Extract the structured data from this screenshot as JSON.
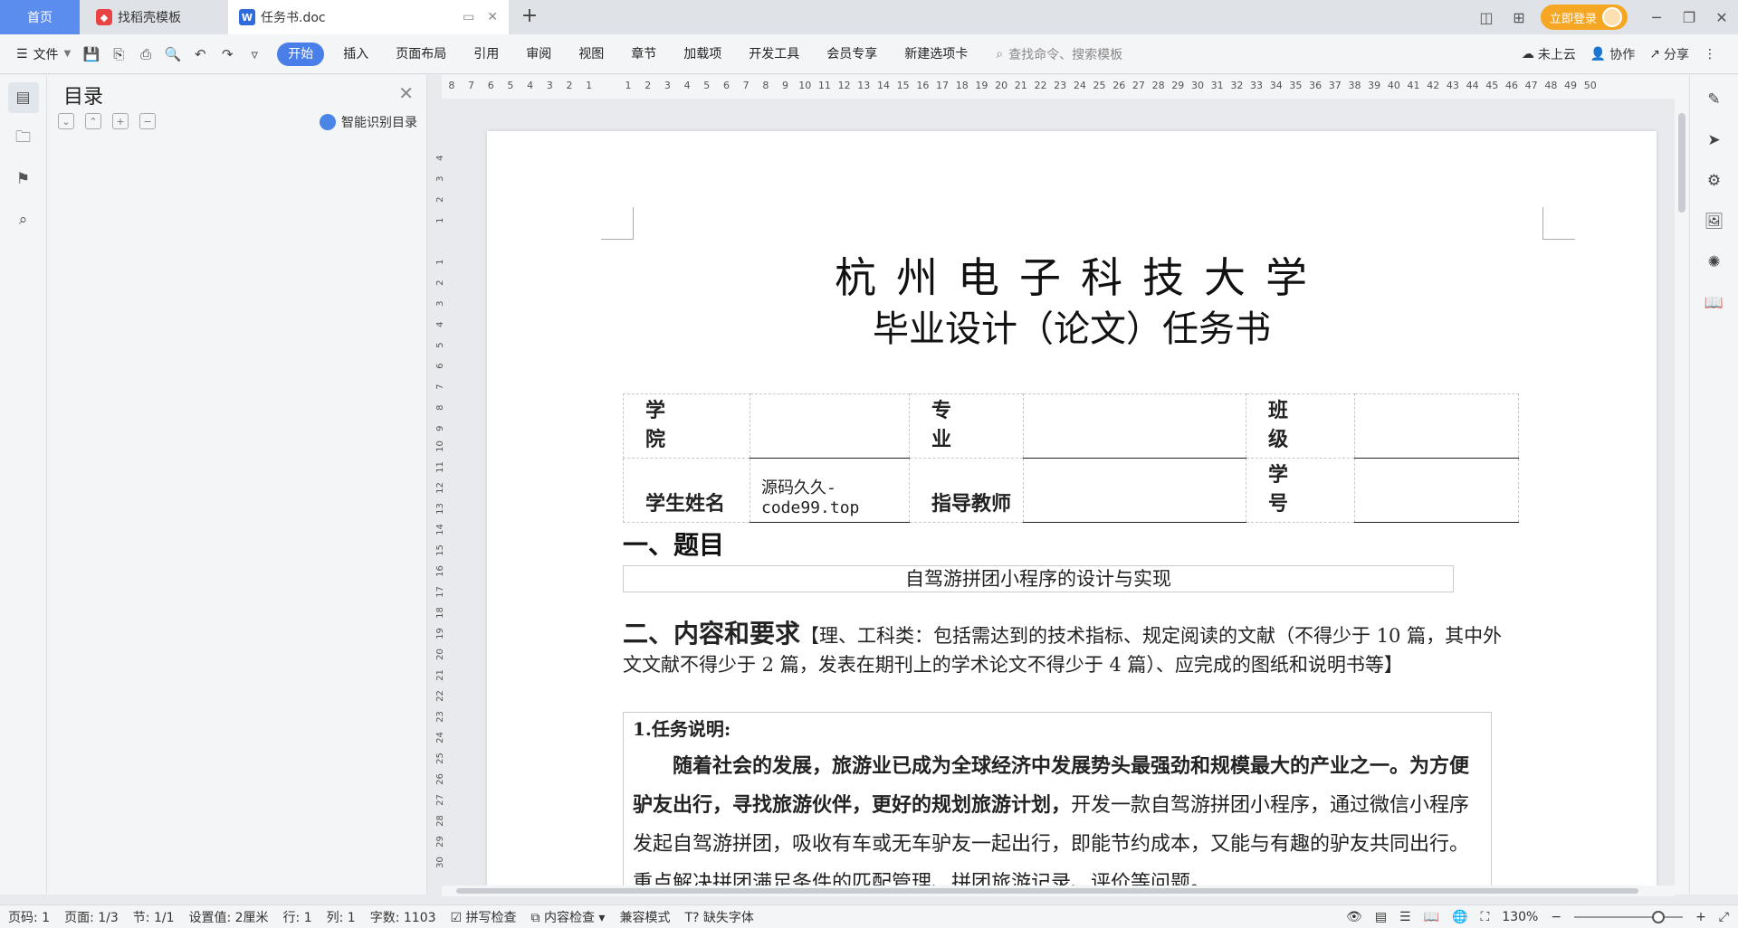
{
  "tabs": {
    "home": "首页",
    "templates": "找稻壳模板",
    "document": "任务书.doc"
  },
  "titlebar": {
    "login": "立即登录"
  },
  "toolbar": {
    "file": "文件",
    "menus": [
      "开始",
      "插入",
      "页面布局",
      "引用",
      "审阅",
      "视图",
      "章节",
      "加载项",
      "开发工具",
      "会员专享",
      "新建选项卡"
    ],
    "search_placeholder": "查找命令、搜索模板",
    "cloud": "未上云",
    "collab": "协作",
    "share": "分享"
  },
  "outline": {
    "title": "目录",
    "smart": "智能识别目录"
  },
  "ruler": {
    "h": [
      "8",
      "7",
      "6",
      "5",
      "4",
      "3",
      "2",
      "1",
      "",
      "1",
      "2",
      "3",
      "4",
      "5",
      "6",
      "7",
      "8",
      "9",
      "10",
      "11",
      "12",
      "13",
      "14",
      "15",
      "16",
      "17",
      "18",
      "19",
      "20",
      "21",
      "22",
      "23",
      "24",
      "25",
      "26",
      "27",
      "28",
      "29",
      "30",
      "31",
      "32",
      "33",
      "34",
      "35",
      "36",
      "37",
      "38",
      "39",
      "40",
      "41",
      "42",
      "43",
      "44",
      "45",
      "46",
      "47",
      "48",
      "49",
      "50"
    ],
    "v": [
      "4",
      "3",
      "2",
      "1",
      "",
      "1",
      "2",
      "3",
      "4",
      "5",
      "6",
      "7",
      "8",
      "9",
      "10",
      "11",
      "12",
      "13",
      "14",
      "15",
      "16",
      "17",
      "18",
      "19",
      "20",
      "21",
      "22",
      "23",
      "24",
      "25",
      "26",
      "27",
      "28",
      "29",
      "30"
    ]
  },
  "document": {
    "university": "杭州电子科技大学",
    "subtitle": "毕业设计（论文）任务书",
    "table": {
      "college_label": "学 院",
      "major_label": "专 业",
      "class_label": "班 级",
      "student_label": "学生姓名",
      "student_value": "源码久久-code99.top",
      "advisor_label": "指导教师",
      "id_label": "学 号"
    },
    "section1": "一、题目",
    "topic": "自驾游拼团小程序的设计与实现",
    "section2": "二、内容和要求",
    "section2_note": "【理、工科类：包括需达到的技术指标、规定阅读的文献（不得少于 10 篇，其中外文文献不得少于 2 篇，发表在期刊上的学术论文不得少于 4 篇）、应完成的图纸和说明书等】",
    "task_heading": "1.任务说明:",
    "task_bold": "随着社会的发展，旅游业已成为全球经济中发展势头最强劲和规模最大的产业之一。为方便驴友出行，寻找旅游伙伴，更好的规划旅游计划，",
    "task_text": "开发一款自驾游拼团小程序，通过微信小程序发起自驾游拼团，吸收有车或无车驴友一起出行，即能节约成本，又能与有趣的驴友共同出行。重点解决拼团满足条件的匹配管理、拼团旅游记录、评价等问题。"
  },
  "status": {
    "page_no": "页码: 1",
    "pages": "页面: 1/3",
    "section": "节: 1/1",
    "setting": "设置值: 2厘米",
    "row": "行: 1",
    "col": "列: 1",
    "words": "字数: 1103",
    "spell": "拼写检查",
    "content_check": "内容检查",
    "compat": "兼容模式",
    "missing_font": "缺失字体",
    "zoom": "130%"
  }
}
